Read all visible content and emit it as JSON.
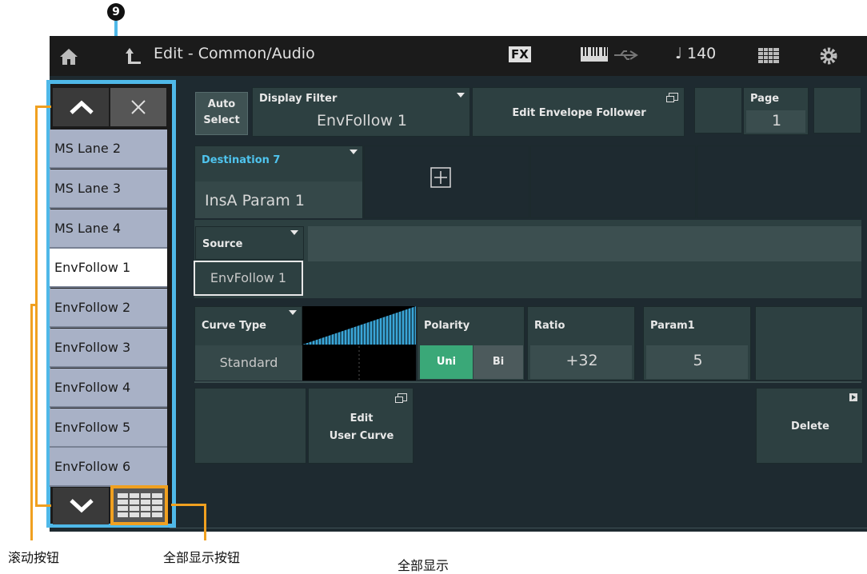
{
  "callout_number": "9",
  "header": {
    "title": "Edit - Common/Audio",
    "fx_label": "FX",
    "tempo": "♩ 140"
  },
  "auto_select": {
    "line1": "Auto",
    "line2": "Select"
  },
  "display_filter": {
    "label": "Display Filter",
    "value": "EnvFollow 1"
  },
  "edit_envelope_follower": "Edit Envelope Follower",
  "page": {
    "label": "Page",
    "value": "1"
  },
  "destination": {
    "label": "Destination 7",
    "value": "InsA Param 1"
  },
  "source": {
    "label": "Source",
    "value": "EnvFollow 1"
  },
  "curve_type": {
    "label": "Curve Type",
    "value": "Standard"
  },
  "polarity": {
    "label": "Polarity",
    "uni": "Uni",
    "bi": "Bi"
  },
  "ratio": {
    "label": "Ratio",
    "value": "+32"
  },
  "param1": {
    "label": "Param1",
    "value": "5"
  },
  "edit_user_curve": {
    "line1": "Edit",
    "line2": "User Curve"
  },
  "delete_label": "Delete",
  "list": {
    "items": [
      "MS Lane 2",
      "MS Lane 3",
      "MS Lane 4",
      "EnvFollow 1",
      "EnvFollow 2",
      "EnvFollow 3",
      "EnvFollow 4",
      "EnvFollow 5",
      "EnvFollow 6"
    ],
    "selected_index": 3
  },
  "annotations": {
    "scroll_buttons": "滚动按钮",
    "show_all_button": "全部显示按钮",
    "show_all": "全部显示"
  },
  "colors": {
    "accent_blue": "#4fb8e8",
    "callout_orange": "#f0a020",
    "uni_green": "#3aa878",
    "destination_text": "#4fc4ee"
  }
}
